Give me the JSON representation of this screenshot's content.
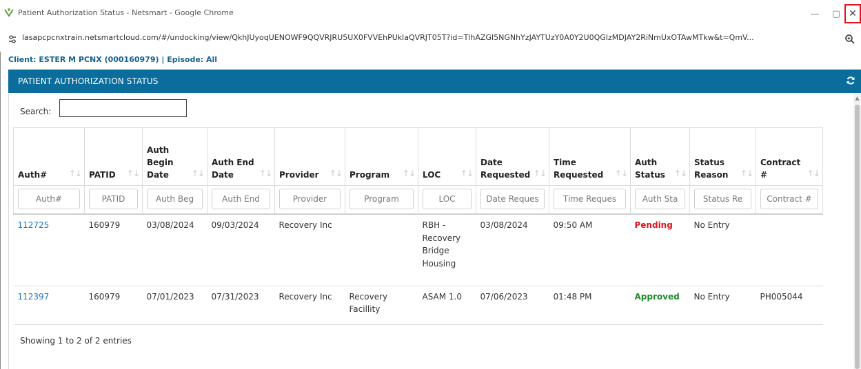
{
  "window": {
    "title": "Patient Authorization Status - Netsmart - Google Chrome",
    "url": "lasapcpcnxtrain.netsmartcloud.com/#/undocking/view/QkhJUyoqUENOWF9QQVRJRU5UX0FVVEhPUklaQVRJT05T?id=TlhAZGI5NGNhYzJAYTUzY0A0Y2U0QGIzMDJAY2RiNmUxOTAwMTkw&t=QmV..."
  },
  "client_line": "Client: ESTER M PCNX (000160979) | Episode: All",
  "panel": {
    "title": "PATIENT AUTHORIZATION STATUS"
  },
  "search": {
    "label": "Search:",
    "value": ""
  },
  "table": {
    "columns": [
      {
        "label": "Auth#",
        "filter_placeholder": "Auth#"
      },
      {
        "label": "PATID",
        "filter_placeholder": "PATID"
      },
      {
        "label": "Auth Begin Date",
        "filter_placeholder": "Auth Beg"
      },
      {
        "label": "Auth End Date",
        "filter_placeholder": "Auth End"
      },
      {
        "label": "Provider",
        "filter_placeholder": "Provider"
      },
      {
        "label": "Program",
        "filter_placeholder": "Program"
      },
      {
        "label": "LOC",
        "filter_placeholder": "LOC"
      },
      {
        "label": "Date Requested",
        "filter_placeholder": "Date Reques"
      },
      {
        "label": "Time Requested",
        "filter_placeholder": "Time Reques"
      },
      {
        "label": "Auth Status",
        "filter_placeholder": "Auth Sta"
      },
      {
        "label": "Status Reason",
        "filter_placeholder": "Status Re"
      },
      {
        "label": "Contract #",
        "filter_placeholder": "Contract #"
      }
    ],
    "rows": [
      {
        "auth": "112725",
        "patid": "160979",
        "begin": "03/08/2024",
        "end": "09/03/2024",
        "provider": "Recovery Inc",
        "program": "",
        "loc": "RBH - Recovery Bridge Housing",
        "date_requested": "03/08/2024",
        "time_requested": "09:50 AM",
        "status": "Pending",
        "status_reason": "No Entry",
        "contract": ""
      },
      {
        "auth": "112397",
        "patid": "160979",
        "begin": "07/01/2023",
        "end": "07/31/2023",
        "provider": "Recovery Inc",
        "program": "Recovery Facillity",
        "loc": "ASAM 1.0",
        "date_requested": "07/06/2023",
        "time_requested": "01:48 PM",
        "status": "Approved",
        "status_reason": "No Entry",
        "contract": "PH005044"
      }
    ]
  },
  "info": "Showing 1 to 2 of 2 entries",
  "colors": {
    "header_blue": "#0a6d9c",
    "link_blue": "#1a73c8",
    "client_blue": "#14628f",
    "pending_red": "#e0141d",
    "approved_green": "#1e8b2d"
  },
  "icons": {
    "app": "netsmart-logo-icon",
    "site": "site-settings-icon",
    "zoom": "zoom-icon",
    "refresh": "refresh-icon",
    "minimize": "minimize-icon",
    "maximize": "maximize-icon",
    "close": "close-icon"
  }
}
